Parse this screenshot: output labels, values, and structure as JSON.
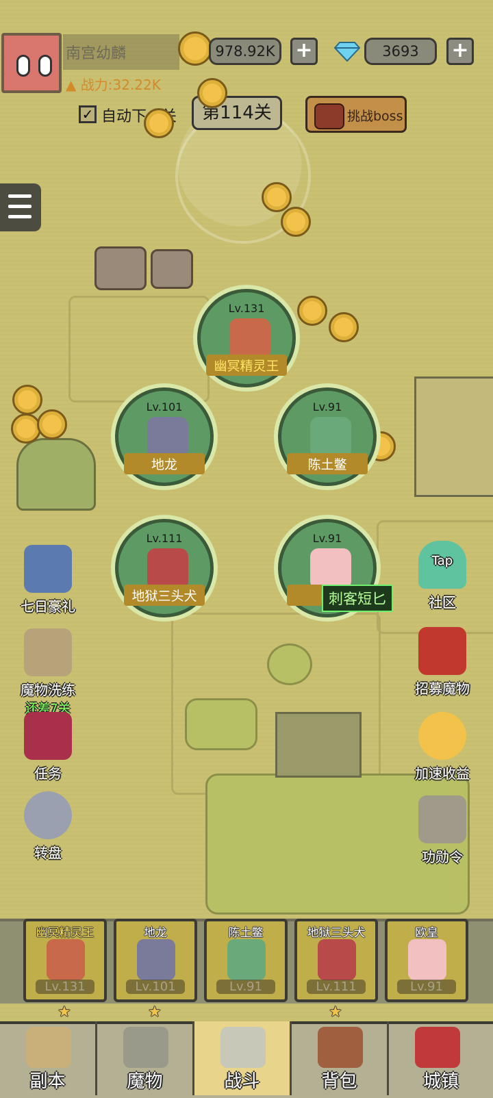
{
  "player": {
    "name": "南宫幼麟",
    "power": "战力:32.22K"
  },
  "currency": {
    "gold": "978.92K",
    "gems": "3693",
    "add": "+"
  },
  "controls": {
    "auto_label": "自动下一关",
    "check": "✓",
    "stage": "第114关",
    "boss_label": "挑战boss"
  },
  "heroes": [
    {
      "level": "Lv.131",
      "name": "幽冥精灵王"
    },
    {
      "level": "Lv.101",
      "name": "地龙"
    },
    {
      "level": "Lv.91",
      "name": "陈土鳖"
    },
    {
      "level": "Lv.111",
      "name": "地狱三头犬"
    },
    {
      "level": "Lv.91",
      "name": "欧"
    }
  ],
  "weapon_tag": "刺客短匕",
  "left_menu": [
    {
      "label": "七日豪礼",
      "sub": ""
    },
    {
      "label": "魔物洗练",
      "sub": "还差7关"
    },
    {
      "label": "任务",
      "sub": ""
    },
    {
      "label": "转盘",
      "sub": ""
    }
  ],
  "right_menu": [
    {
      "label": "社区",
      "icon_text": "Tap"
    },
    {
      "label": "招募魔物"
    },
    {
      "label": "加速收益"
    },
    {
      "label": "功勋令"
    }
  ],
  "roster": [
    {
      "name": "幽冥精灵王",
      "level": "Lv.131"
    },
    {
      "name": "地龙",
      "level": "Lv.101"
    },
    {
      "name": "陈土鳖",
      "level": "Lv.91"
    },
    {
      "name": "地狱三头犬",
      "level": "Lv.111"
    },
    {
      "name": "欧皇",
      "level": "Lv.91"
    }
  ],
  "star": "★",
  "nav": [
    {
      "label": "副本"
    },
    {
      "label": "魔物"
    },
    {
      "label": "战斗"
    },
    {
      "label": "背包"
    },
    {
      "label": "城镇"
    }
  ],
  "active_tab": "战斗"
}
